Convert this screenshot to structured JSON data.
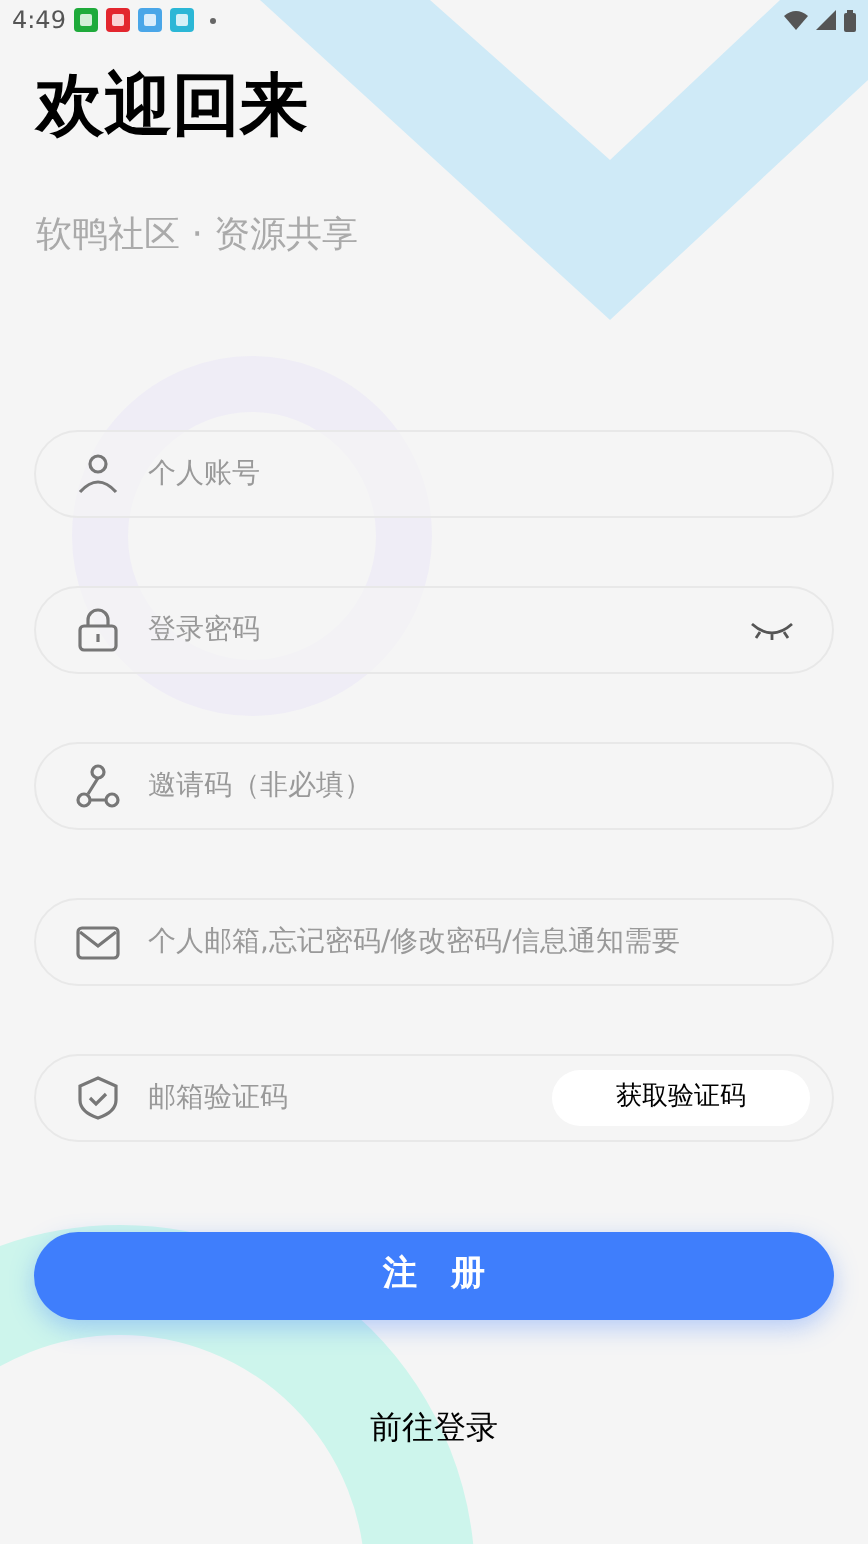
{
  "status_bar": {
    "time": "4:49",
    "notifications": [
      {
        "color": "#1faa3b"
      },
      {
        "color": "#e3262e"
      },
      {
        "color": "#4aa6e8"
      },
      {
        "color": "#2bb7d6"
      }
    ]
  },
  "title": "欢迎回来",
  "subtitle": "软鸭社区 · 资源共享",
  "fields": [
    {
      "kind": "account",
      "placeholder": "个人账号"
    },
    {
      "kind": "password",
      "placeholder": "登录密码"
    },
    {
      "kind": "invite",
      "placeholder": "邀请码（非必填）"
    },
    {
      "kind": "email",
      "placeholder": "个人邮箱,忘记密码/修改密码/信息通知需要"
    },
    {
      "kind": "code",
      "placeholder": "邮箱验证码",
      "button": "获取验证码"
    }
  ],
  "submit": "注　册",
  "login_link": "前往登录"
}
